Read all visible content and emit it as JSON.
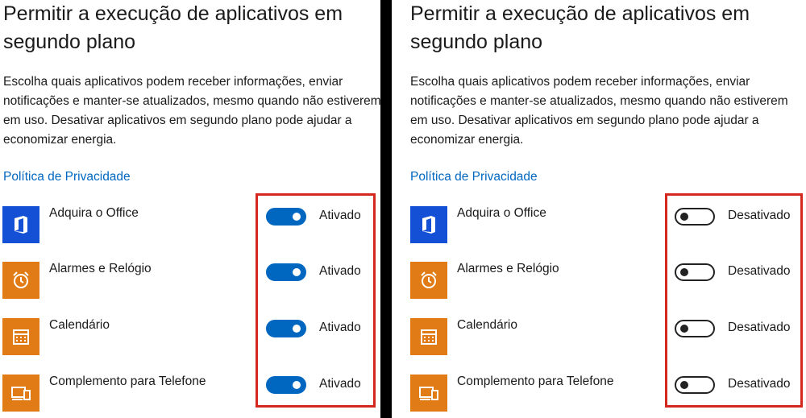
{
  "colors": {
    "toggle_on": "#0067c0",
    "link": "#0067c0",
    "office_tile": "#1450d6",
    "orange_tile": "#e07b15",
    "highlight": "#d4281e"
  },
  "panels": [
    {
      "title": "Permitir a execução de aplicativos em segundo plano",
      "description": "Escolha quais aplicativos podem receber informações, enviar notificações e manter-se atualizados, mesmo quando não estiverem em uso. Desativar aplicativos em segundo plano pode ajudar a economizar energia.",
      "privacy_link": "Política de Privacidade",
      "apps": [
        {
          "name": "Adquira o Office",
          "icon": "office-icon",
          "state": "Ativado",
          "on": true
        },
        {
          "name": "Alarmes e Relógio",
          "icon": "alarm-clock-icon",
          "state": "Ativado",
          "on": true
        },
        {
          "name": "Calendário",
          "icon": "calendar-icon",
          "state": "Ativado",
          "on": true
        },
        {
          "name": "Complemento para Telefone",
          "icon": "phone-companion-icon",
          "state": "Ativado",
          "on": true
        }
      ]
    },
    {
      "title": "Permitir a execução de aplicativos em segundo plano",
      "description": "Escolha quais aplicativos podem receber informações, enviar notificações e manter-se atualizados, mesmo quando não estiverem em uso. Desativar aplicativos em segundo plano pode ajudar a economizar energia.",
      "privacy_link": "Política de Privacidade",
      "apps": [
        {
          "name": "Adquira o Office",
          "icon": "office-icon",
          "state": "Desativado",
          "on": false
        },
        {
          "name": "Alarmes e Relógio",
          "icon": "alarm-clock-icon",
          "state": "Desativado",
          "on": false
        },
        {
          "name": "Calendário",
          "icon": "calendar-icon",
          "state": "Desativado",
          "on": false
        },
        {
          "name": "Complemento para Telefone",
          "icon": "phone-companion-icon",
          "state": "Desativado",
          "on": false
        }
      ]
    }
  ]
}
